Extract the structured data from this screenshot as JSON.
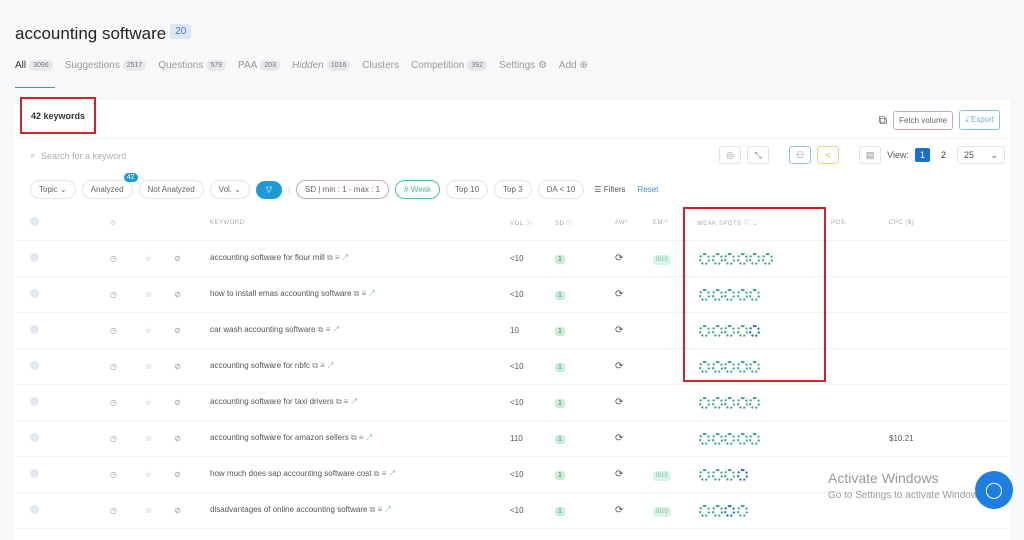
{
  "title": "accounting software",
  "title_badge": "20",
  "tabs": [
    {
      "label": "All",
      "count": "3096"
    },
    {
      "label": "Suggestions",
      "count": "2517"
    },
    {
      "label": "Questions",
      "count": "579"
    },
    {
      "label": "PAA",
      "count": "203"
    },
    {
      "label": "Hidden",
      "count": "1016"
    },
    {
      "label": "Clusters"
    },
    {
      "label": "Competition",
      "count": "392"
    },
    {
      "label": "Settings ⚙"
    },
    {
      "label": "Add ⊕"
    }
  ],
  "keyword_count": "42 keywords",
  "buttons": {
    "fetch": "Fetch volume",
    "export": "⤓ Export"
  },
  "search_placeholder": "Search for a keyword",
  "view": {
    "label": "View:",
    "pages": [
      "1",
      "2"
    ],
    "per_page": "25"
  },
  "filters": {
    "topic": "Topic ⌄",
    "analyzed": "Analyzed",
    "analyzed_count": "42",
    "not_analyzed": "Not Analyzed",
    "vol": "Vol. ⌄",
    "sd": "SD | min : 1 - max : 1",
    "weak": "# Weak",
    "top10": "Top 10",
    "top3": "Top 3",
    "da": "DA < 10",
    "more": "Filters",
    "reset": "Reset"
  },
  "columns": {
    "keyword": "KEYWORD",
    "vol": "VOL.ⓘ",
    "sd": "SD ⓘ",
    "w": "#W³",
    "em": "EM¹⁰",
    "weak": "WEAK SPOTS ⓘ ⌄",
    "pos": "POS.",
    "cpc": "CPC ($)"
  },
  "rows": [
    {
      "keyword": "accounting software for flour mill",
      "vol": "<10",
      "sd": "1",
      "em": "0/10",
      "spots": "gggggg",
      "cpc": ""
    },
    {
      "keyword": "how to install emas accounting software",
      "vol": "<10",
      "sd": "1",
      "em": "",
      "spots": "ggggg",
      "cpc": ""
    },
    {
      "keyword": "car wash accounting software",
      "vol": "10",
      "sd": "1",
      "em": "",
      "spots": "ggggb",
      "cpc": ""
    },
    {
      "keyword": "accounting software for nbfc",
      "vol": "<10",
      "sd": "1",
      "em": "",
      "spots": "ggggg",
      "cpc": ""
    },
    {
      "keyword": "accounting software for taxi drivers",
      "vol": "<10",
      "sd": "1",
      "em": "",
      "spots": "ggggg",
      "cpc": ""
    },
    {
      "keyword": "accounting software for amazon sellers",
      "vol": "110",
      "sd": "1",
      "em": "",
      "spots": "ggggg",
      "cpc": "$10.21"
    },
    {
      "keyword": "how much does sap accounting software cost",
      "vol": "<10",
      "sd": "1",
      "em": "0/10",
      "spots": "gggb",
      "cpc": ""
    },
    {
      "keyword": "disadvantages of online accounting software",
      "vol": "<10",
      "sd": "1",
      "em": "0/10",
      "spots": "ggbg",
      "cpc": ""
    }
  ],
  "watermark": {
    "line1": "Activate Windows",
    "line2": "Go to Settings to activate Windows."
  }
}
